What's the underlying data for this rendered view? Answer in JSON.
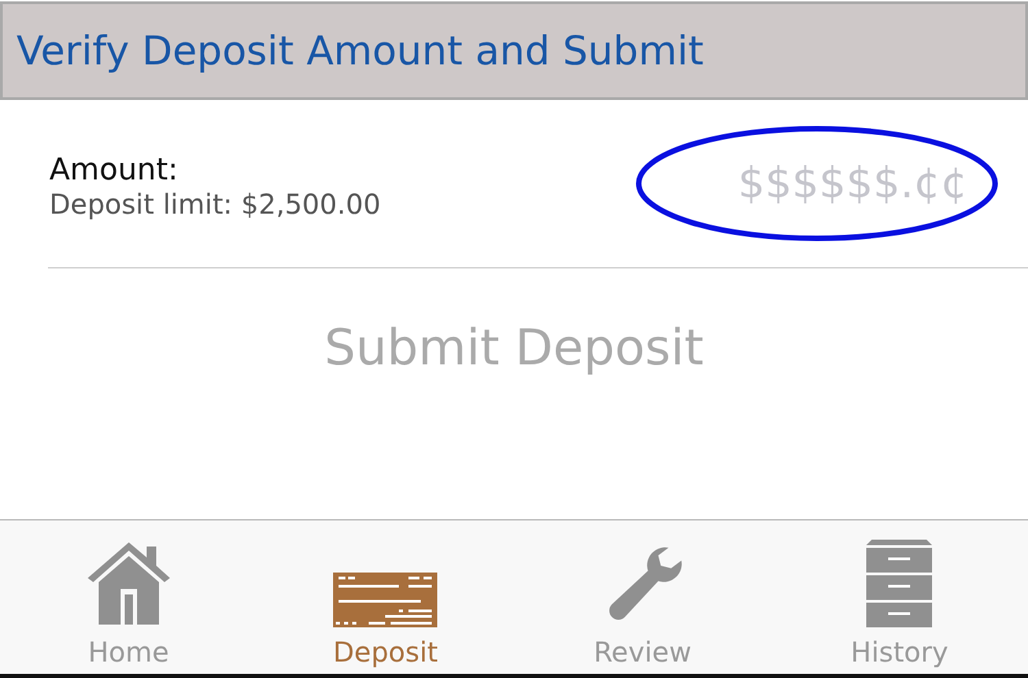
{
  "header": {
    "title": "Verify Deposit Amount and Submit"
  },
  "amount": {
    "label": "Amount:",
    "limit": "Deposit limit: $2,500.00",
    "placeholder": "$$$$$$.¢¢",
    "highlighted": true
  },
  "submit": {
    "label": "Submit Deposit",
    "disabled": true
  },
  "tabs": [
    {
      "label": "Home",
      "kind": "home",
      "selected": false
    },
    {
      "label": "Deposit",
      "kind": "check",
      "selected": true
    },
    {
      "label": "Review",
      "kind": "wrench",
      "selected": false
    },
    {
      "label": "History",
      "kind": "cabinet",
      "selected": false
    }
  ]
}
